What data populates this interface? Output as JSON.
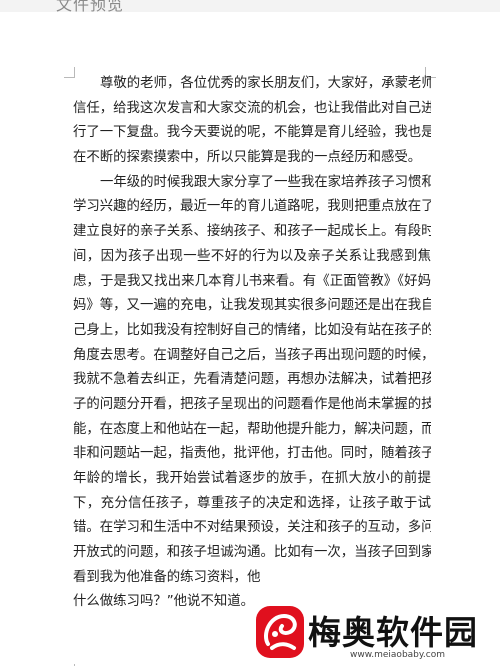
{
  "window": {
    "title": "文件预览"
  },
  "document": {
    "lines": [
      "尊敬的老师，各位优秀的家长朋友们，大家好，承蒙老师",
      "信任，给我这次发言和大家交流的机会，也让我借此对自己进",
      "行了一下复盘。我今天要说的呢，不能算是育儿经验，我也是",
      "在不断的探索摸索中，所以只能算是我的一点经历和感受。",
      "一年级的时候我跟大家分享了一些我在家培养孩子习惯和",
      "学习兴趣的经历，最近一年的育儿道路呢，我则把重点放在了",
      "建立良好的亲子关系、接纳孩子、和孩子一起成长上。有段时",
      "间，因为孩子出现一些不好的行为以及亲子关系让我感到焦",
      "虑，于是我又找出来几本育儿书来看。有《正面管教》《好妈",
      "妈》等，又一遍的充电，让我发现其实很多问题还是出在我自",
      "己身上，比如我没有控制好自己的情绪，比如没有站在孩子的",
      "角度去思考。在调整好自己之后，当孩子再出现问题的时候，",
      "我就不急着去纠正，先看清楚问题，再想办法解决，试着把孩",
      "子的问题分开看，把孩子呈现出的问题看作是他尚未掌握的技",
      "能，在态度上和他站在一起，帮助他提升能力，解决问题，而",
      "非和问题站一起，指责他，批评他，打击他。同时，随着孩子",
      "年龄的增长，我开始尝试着逐步的放手，在抓大放小的前提",
      "下，充分信任孩子，尊重孩子的决定和选择，让孩子敢于试",
      "错。在学习和生活中不对结果预设，关注和孩子的互动，多问",
      "开放式的问题，和孩子坦诚沟通。比如有一次，当孩子回到家",
      "看到我为他准备的练习资料，他",
      "什么做练习吗？”他说不知道。"
    ]
  },
  "watermark": {
    "name": "梅奥软件园",
    "url": "www.meiaobaby.com",
    "logo_icon": "meiao-logo-icon",
    "brand_color": "#e0101e"
  }
}
